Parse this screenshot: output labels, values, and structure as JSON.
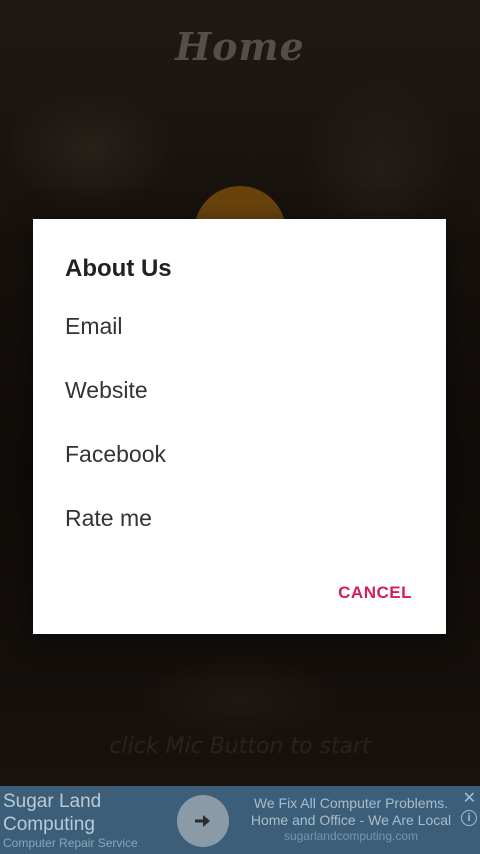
{
  "screen": {
    "title": "Home",
    "hint": "click Mic Button to start"
  },
  "dialog": {
    "title": "About Us",
    "items": [
      {
        "label": "Email"
      },
      {
        "label": "Website"
      },
      {
        "label": "Facebook"
      },
      {
        "label": "Rate me"
      }
    ],
    "cancel_label": "CANCEL"
  },
  "ad": {
    "title": "Sugar Land Computing",
    "subtitle": "Computer Repair Service",
    "text": "We Fix All Computer Problems. Home and Office - We Are Local",
    "domain": "sugarlandcomputing.com",
    "close_glyph": "✕",
    "info_glyph": "i"
  },
  "colors": {
    "accent": "#d81b60",
    "mic": "#c07a14",
    "ad_bg": "#3c5e78"
  }
}
